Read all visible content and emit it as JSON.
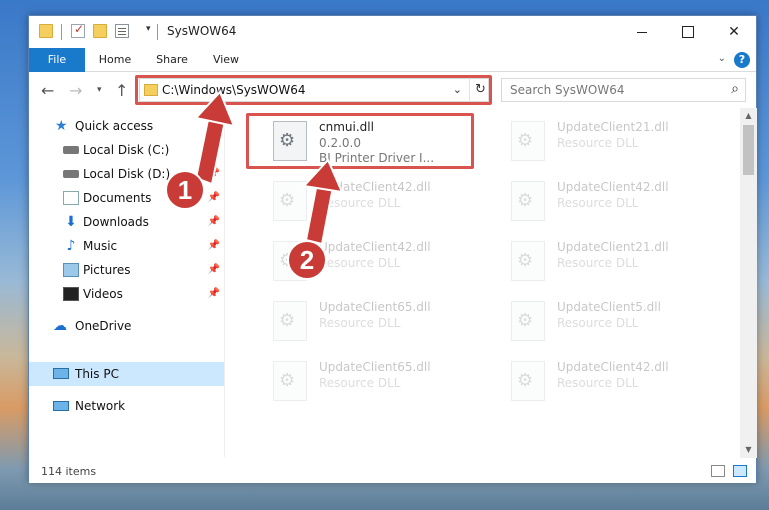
{
  "window": {
    "title": "SysWOW64"
  },
  "ribbon": {
    "tabs": [
      {
        "label": "File"
      },
      {
        "label": "Home"
      },
      {
        "label": "Share"
      },
      {
        "label": "View"
      }
    ]
  },
  "address": {
    "path": "C:\\Windows\\SysWOW64",
    "search_placeholder": "Search SysWOW64"
  },
  "sidebar": {
    "items": [
      {
        "label": "Quick access",
        "icon": "star-icon"
      },
      {
        "label": "Local Disk (C:)",
        "icon": "drive-icon"
      },
      {
        "label": "Local Disk (D:)",
        "icon": "drive-icon"
      },
      {
        "label": "Documents",
        "icon": "documents-icon"
      },
      {
        "label": "Downloads",
        "icon": "download-icon"
      },
      {
        "label": "Music",
        "icon": "music-icon"
      },
      {
        "label": "Pictures",
        "icon": "pictures-icon"
      },
      {
        "label": "Videos",
        "icon": "videos-icon"
      },
      {
        "label": "OneDrive",
        "icon": "cloud-icon"
      },
      {
        "label": "This PC",
        "icon": "computer-icon"
      },
      {
        "label": "Network",
        "icon": "network-icon"
      }
    ]
  },
  "files": [
    {
      "name": "cnmui.dll",
      "line2": "0.2.0.0",
      "line3": "BJ Printer Driver I..."
    },
    {
      "name": "UpdateClient21.dll",
      "line2": "Resource DLL"
    },
    {
      "name": "UpdateClient42.dll",
      "line2": "Resource DLL"
    },
    {
      "name": "UpdateClient42.dll",
      "line2": "Resource DLL"
    },
    {
      "name": "UpdateClient42.dll",
      "line2": "Resource DLL"
    },
    {
      "name": "UpdateClient21.dll",
      "line2": "Resource DLL"
    },
    {
      "name": "UpdateClient65.dll",
      "line2": "Resource DLL"
    },
    {
      "name": "UpdateClient5.dll",
      "line2": "Resource DLL"
    },
    {
      "name": "UpdateClient65.dll",
      "line2": "Resource DLL"
    },
    {
      "name": "UpdateClient42.dll",
      "line2": "Resource DLL"
    }
  ],
  "status": {
    "item_count": "114 items"
  },
  "annotations": {
    "marker1": "1",
    "marker2": "2"
  },
  "colors": {
    "accent": "#1979ca",
    "highlight": "#d9534f",
    "selected": "#cce8ff"
  }
}
